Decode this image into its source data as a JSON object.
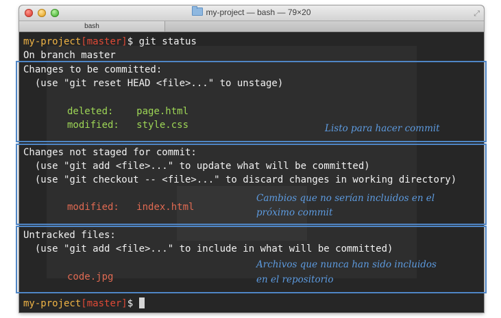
{
  "window": {
    "title": "my-project — bash — 79×20",
    "tab_label": "bash"
  },
  "prompt": {
    "host": "my-project",
    "branch": "[master]",
    "symbol": "$ "
  },
  "command": "git status",
  "lines": {
    "on_branch": "On branch master",
    "staged_header": "Changes to be committed:",
    "staged_hint": "  (use \"git reset HEAD <file>...\" to unstage)",
    "staged_files": [
      {
        "status": "deleted:    ",
        "file": "page.html"
      },
      {
        "status": "modified:   ",
        "file": "style.css"
      }
    ],
    "unstaged_header": "Changes not staged for commit:",
    "unstaged_hint1": "  (use \"git add <file>...\" to update what will be committed)",
    "unstaged_hint2": "  (use \"git checkout -- <file>...\" to discard changes in working directory)",
    "unstaged_files": [
      {
        "status": "modified:   ",
        "file": "index.html"
      }
    ],
    "untracked_header": "Untracked files:",
    "untracked_hint": "  (use \"git add <file>...\" to include in what will be committed)",
    "untracked_files": [
      "code.jpg"
    ]
  },
  "annotations": {
    "staged": "Listo para hacer commit",
    "unstaged_line1": "Cambios que no serían incluidos en el",
    "unstaged_line2": "próximo commit",
    "untracked_line1": "Archivos que nunca han sido incluidos",
    "untracked_line2": "en el repositorio"
  },
  "colors": {
    "prompt_host": "#f0b445",
    "prompt_branch": "#e04a36",
    "staged_text": "#9ed656",
    "unstaged_text": "#e06a52",
    "annotation": "#5d9be0",
    "box_border": "#4f86c6",
    "terminal_bg": "#262626"
  },
  "icons": {
    "window_controls": [
      "close-icon",
      "minimize-icon",
      "maximize-icon"
    ],
    "title_folder": "folder-icon",
    "fullscreen": "fullscreen-icon"
  }
}
